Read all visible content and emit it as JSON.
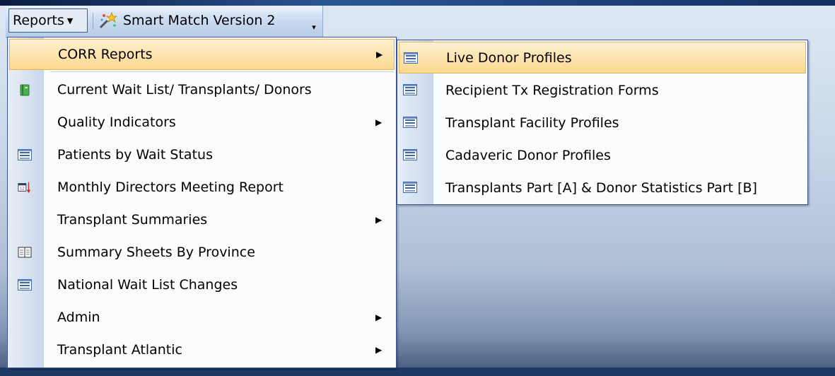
{
  "toolbar": {
    "reports_label": "Reports",
    "smart_match_label": "Smart Match Version 2"
  },
  "menu": {
    "items": [
      {
        "label": "CORR Reports",
        "icon": "none",
        "has_submenu": true,
        "highlighted": true
      },
      {
        "label": "Current Wait List/ Transplants/ Donors",
        "icon": "green-book-icon",
        "has_submenu": false
      },
      {
        "label": "Quality Indicators",
        "icon": "none",
        "has_submenu": true
      },
      {
        "label": "Patients by Wait Status",
        "icon": "form-icon",
        "has_submenu": false
      },
      {
        "label": "Monthly Directors Meeting Report",
        "icon": "calendar-sort-icon",
        "has_submenu": false
      },
      {
        "label": "Transplant Summaries",
        "icon": "none",
        "has_submenu": true
      },
      {
        "label": "Summary Sheets By Province",
        "icon": "open-book-icon",
        "has_submenu": false
      },
      {
        "label": "National Wait List Changes",
        "icon": "form-icon",
        "has_submenu": false
      },
      {
        "label": "Admin",
        "icon": "none",
        "has_submenu": true
      },
      {
        "label": "Transplant Atlantic",
        "icon": "none",
        "has_submenu": true
      }
    ]
  },
  "submenu": {
    "items": [
      {
        "label": "Live Donor Profiles",
        "icon": "form-icon",
        "highlighted": true
      },
      {
        "label": "Recipient Tx Registration Forms",
        "icon": "form-icon"
      },
      {
        "label": "Transplant Facility Profiles",
        "icon": "form-icon"
      },
      {
        "label": "Cadaveric Donor Profiles",
        "icon": "form-icon"
      },
      {
        "label": "Transplants Part [A] & Donor Statistics Part [B]",
        "icon": "form-icon"
      }
    ]
  },
  "colors": {
    "highlight": "#fbd88f",
    "menu_border": "#3b5590",
    "gutter": "#c9d7ec"
  }
}
